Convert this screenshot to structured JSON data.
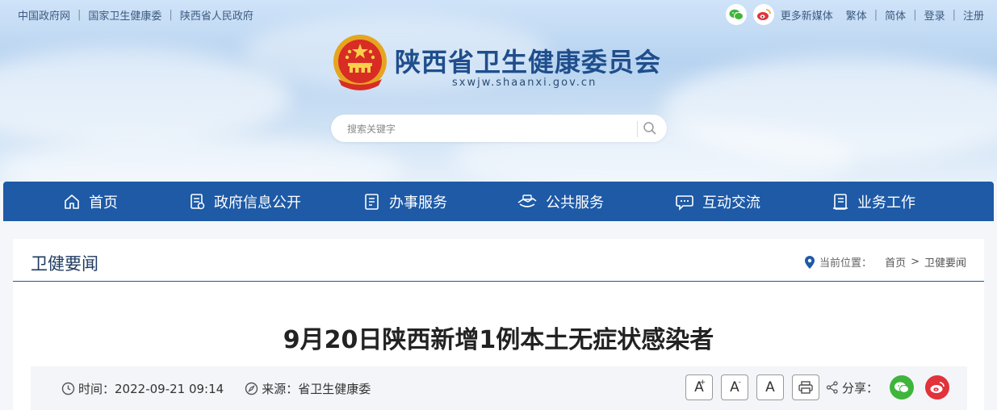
{
  "top_links": [
    "中国政府网",
    "国家卫生健康委",
    "陕西省人民政府"
  ],
  "top_right": {
    "more_media": "更多新媒体",
    "traditional": "繁体",
    "simplified": "简体",
    "login": "登录",
    "register": "注册"
  },
  "site": {
    "title": "陕西省卫生健康委员会",
    "domain": "sxwjw.shaanxi.gov.cn"
  },
  "search": {
    "placeholder": "搜索关键字"
  },
  "nav": {
    "items": [
      {
        "label": "首页",
        "icon": "home-icon"
      },
      {
        "label": "政府信息公开",
        "icon": "document-list-icon"
      },
      {
        "label": "办事服务",
        "icon": "form-icon"
      },
      {
        "label": "公共服务",
        "icon": "handshake-icon"
      },
      {
        "label": "互动交流",
        "icon": "chat-icon"
      },
      {
        "label": "业务工作",
        "icon": "book-icon"
      }
    ]
  },
  "section": {
    "title": "卫健要闻",
    "breadcrumb_label": "当前位置：",
    "breadcrumb": [
      "首页",
      "卫健要闻"
    ]
  },
  "article": {
    "title": "9月20日陕西新增1例本土无症状感染者",
    "time_label": "时间：",
    "time": "2022-09-21 09:14",
    "source_label": "来源：",
    "source": "省卫生健康委",
    "font_large": "A",
    "font_medium": "A",
    "font_small": "A",
    "share_label": "分享："
  },
  "colors": {
    "nav_bg": "#1e5aa6",
    "title_blue": "#1f4e8c",
    "wechat_green": "#3fb53b",
    "weibo_red": "#e2323a"
  }
}
